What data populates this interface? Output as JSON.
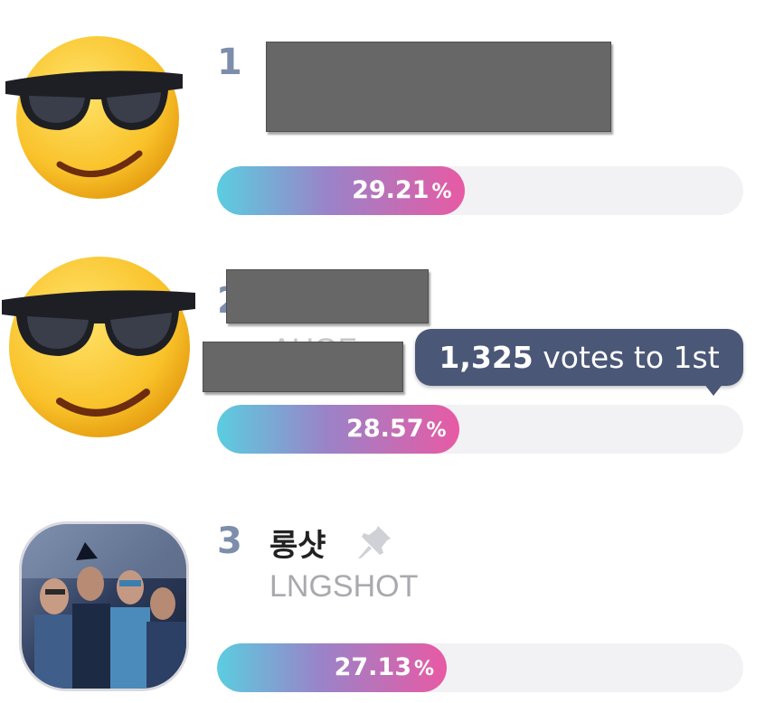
{
  "entries": [
    {
      "rank": "1",
      "percent": "29.21",
      "unit": "%",
      "fraction": 0.2921
    },
    {
      "rank": "2",
      "percent": "28.57",
      "unit": "%",
      "fraction": 0.2857
    },
    {
      "rank": "3",
      "name": "롱샷",
      "subname": "LNGSHOT",
      "percent": "27.13",
      "unit": "%",
      "fraction": 0.2713
    }
  ],
  "tooltip": {
    "count": "1,325",
    "text": "votes to 1st"
  },
  "partial_text": "AHOF",
  "colors": {
    "rank": "#7d8eaa",
    "tooltip_bg": "#4b5777",
    "gradient_start": "#5bcde0",
    "gradient_end": "#e85aa4",
    "track": "#f2f2f4"
  },
  "icons": [
    "sunglasses-emoji-icon",
    "pin-icon"
  ]
}
